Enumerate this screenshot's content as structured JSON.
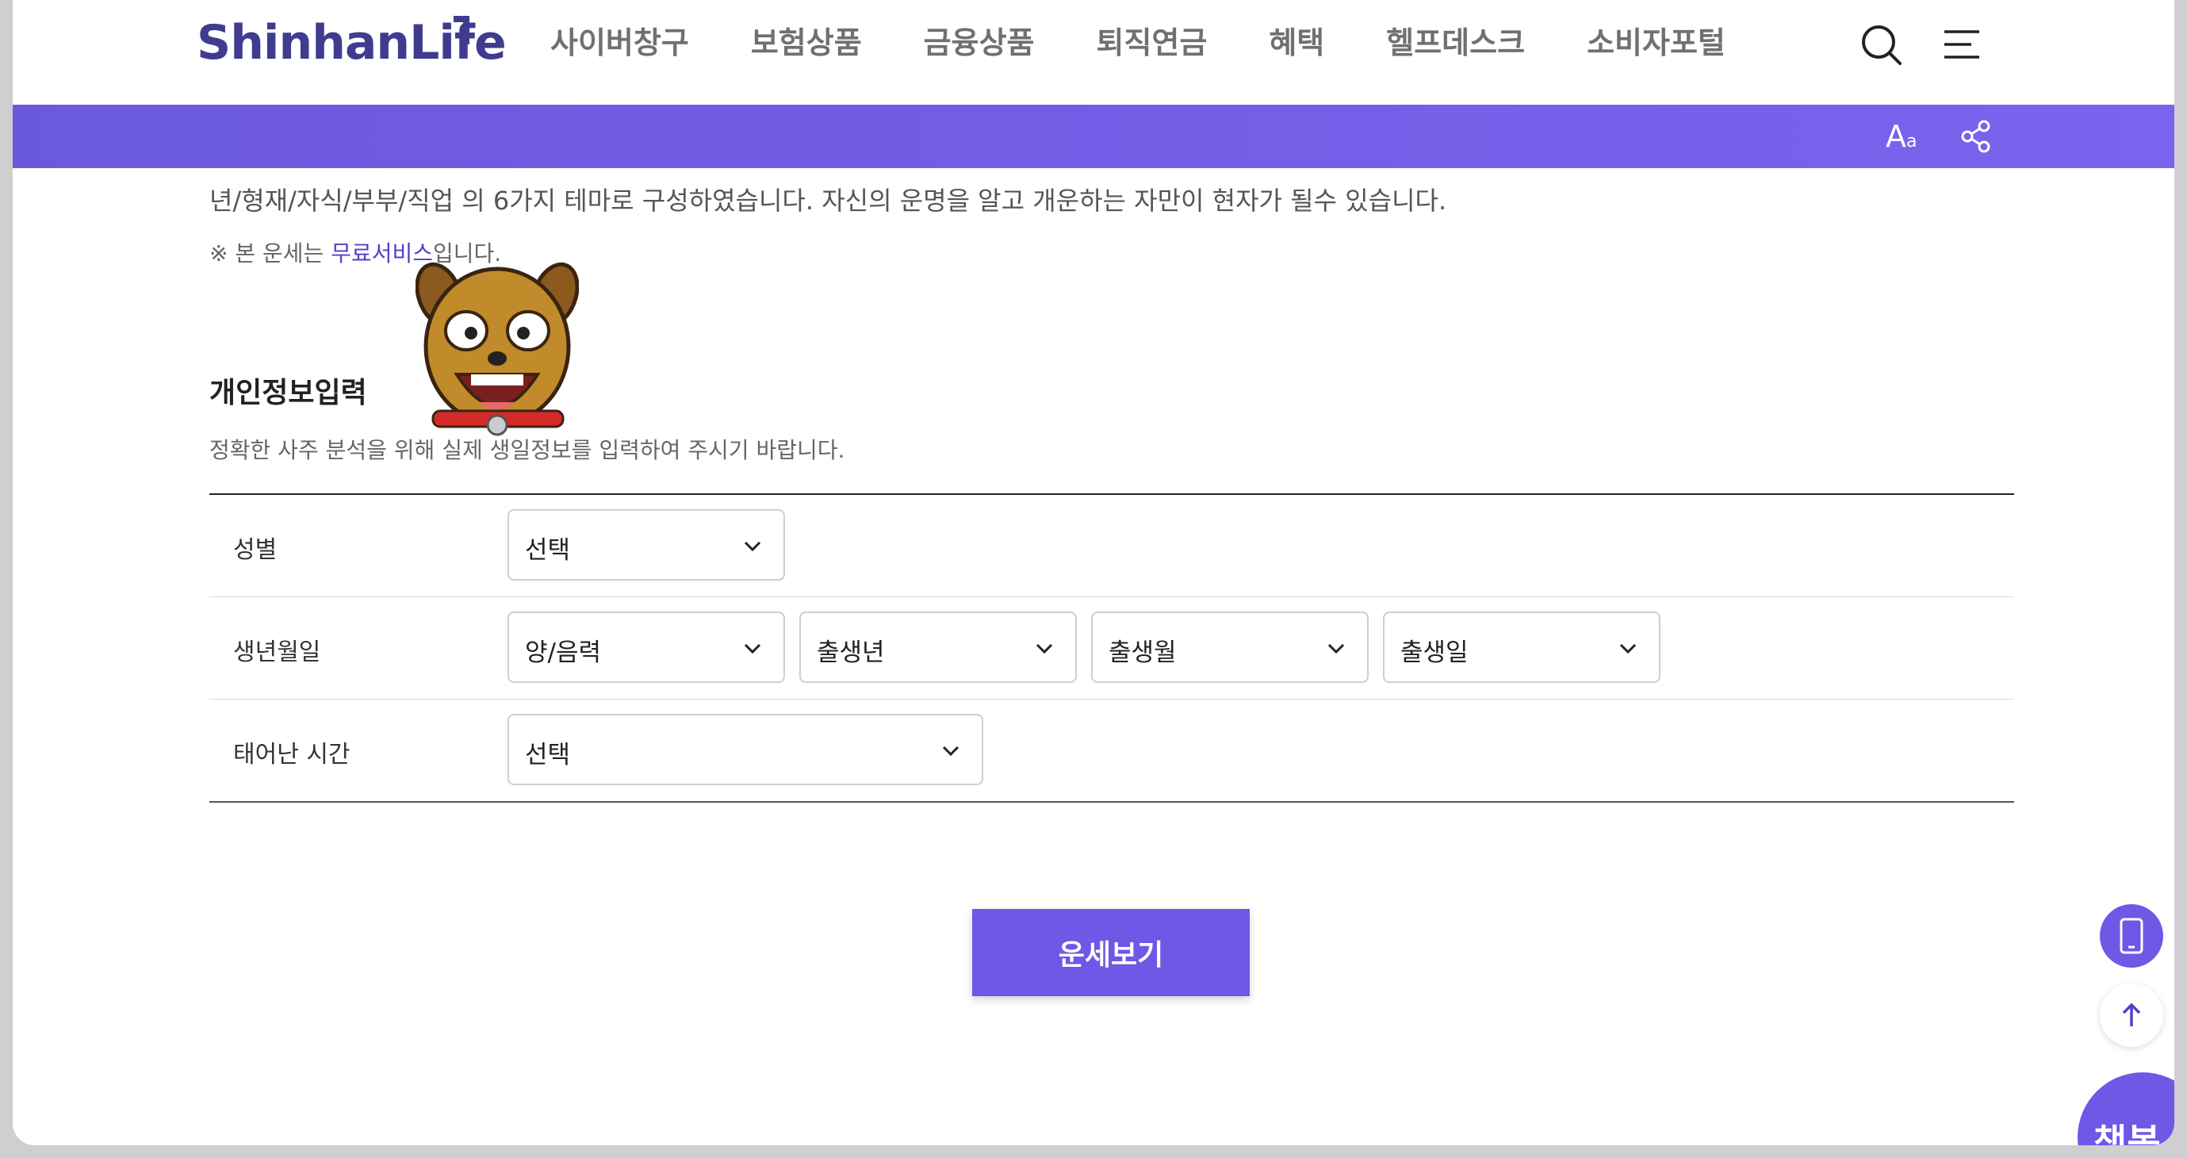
{
  "header": {
    "logo": "ShinhanLife",
    "nav": [
      "사이버창구",
      "보험상품",
      "금융상품",
      "퇴직연금",
      "혜택",
      "헬프데스크",
      "소비자포털"
    ],
    "search_icon": "search-icon",
    "menu_icon": "hamburger-menu-icon"
  },
  "toolbar": {
    "font_size_label_big": "A",
    "font_size_label_small": "a",
    "share_icon": "share-icon",
    "color": "#6e58e6"
  },
  "intro": {
    "text": "년/형재/자식/부부/직업 의 6가지 테마로 구성하였습니다. 자신의 운명을 알고 개운하는 자만이 현자가 될수 있습니다.",
    "notice_prefix": "※ 본 운세는 ",
    "notice_highlight": "무료서비스",
    "notice_suffix": "입니다."
  },
  "form": {
    "title": "개인정보입력",
    "description": "정확한 사주 분석을 위해 실제 생일정보를 입력하여 주시기 바랍니다.",
    "rows": [
      {
        "label": "성별",
        "selects": [
          "선택"
        ]
      },
      {
        "label": "생년월일",
        "selects": [
          "양/음력",
          "출생년",
          "출생월",
          "출생일"
        ]
      },
      {
        "label": "태어난 시간",
        "selects": [
          "선택"
        ]
      }
    ]
  },
  "submit_label": "운세보기",
  "floating": {
    "mobile_icon": "mobile-phone-icon",
    "top_icon": "arrow-up-icon",
    "chatbot_label": "챗봇"
  }
}
